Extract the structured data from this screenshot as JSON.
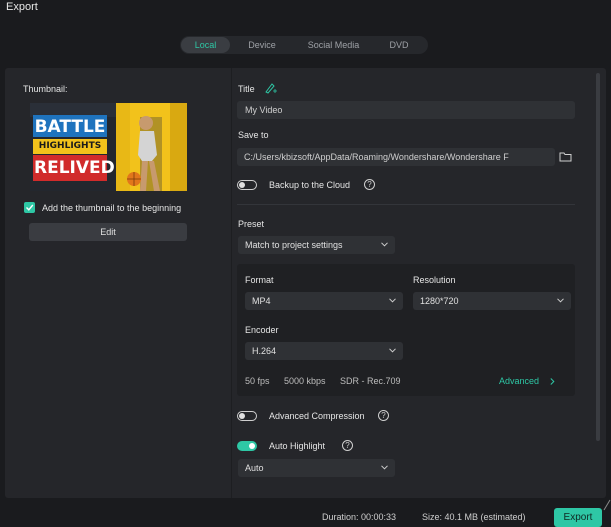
{
  "window": {
    "title": "Export"
  },
  "tabs": [
    {
      "label": "Local",
      "active": true
    },
    {
      "label": "Device",
      "active": false
    },
    {
      "label": "Social Media",
      "active": false
    },
    {
      "label": "DVD",
      "active": false
    }
  ],
  "thumbnail": {
    "label": "Thumbnail:",
    "image_text": {
      "line1": "BATTLE",
      "line2": "HIGHLIGHTS",
      "line3": "RELIVED"
    },
    "add_to_beginning": {
      "label": "Add the thumbnail to the beginning",
      "checked": true
    },
    "edit_label": "Edit"
  },
  "title_field": {
    "label": "Title",
    "value": "My Video",
    "icon": "ai-pen-icon"
  },
  "save_to": {
    "label": "Save to",
    "value": "C:/Users/kbizsoft/AppData/Roaming/Wondershare/Wondershare F",
    "icon": "folder-icon"
  },
  "backup": {
    "label": "Backup to the Cloud",
    "enabled": false
  },
  "preset": {
    "label": "Preset",
    "value": "Match to project settings"
  },
  "format": {
    "label": "Format",
    "value": "MP4"
  },
  "resolution": {
    "label": "Resolution",
    "value": "1280*720"
  },
  "encoder": {
    "label": "Encoder",
    "value": "H.264"
  },
  "summary": {
    "fps": "50 fps",
    "bitrate": "5000 kbps",
    "color": "SDR - Rec.709",
    "advanced_label": "Advanced"
  },
  "advanced_compression": {
    "label": "Advanced Compression",
    "enabled": false
  },
  "auto_highlight": {
    "label": "Auto Highlight",
    "enabled": true,
    "mode": "Auto"
  },
  "footer": {
    "duration": "Duration: 00:00:33",
    "size": "Size:  40.1 MB (estimated)",
    "export_label": "Export"
  },
  "colors": {
    "accent": "#2ec7a5",
    "background": "#1a1b1e",
    "panel": "#25262a"
  }
}
